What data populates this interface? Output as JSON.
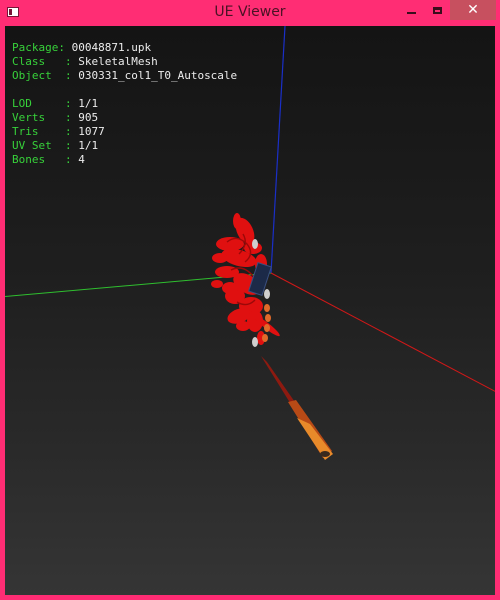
{
  "window": {
    "title": "UE Viewer",
    "close_glyph": "✕",
    "icons": {
      "app": "app-icon",
      "minimize": "minimize-icon",
      "maximize": "maximize-icon",
      "close": "close-icon"
    }
  },
  "hud": {
    "package": {
      "label": "Package: ",
      "value": "00048871.upk"
    },
    "class": {
      "label": "Class   : ",
      "value": "SkeletalMesh"
    },
    "object": {
      "label": "Object  : ",
      "value": "030331_col1_T0_Autoscale"
    },
    "lod": {
      "label": "LOD     : ",
      "value": "1/1"
    },
    "verts": {
      "label": "Verts   : ",
      "value": "905"
    },
    "tris": {
      "label": "Tris    : ",
      "value": "1077"
    },
    "uvset": {
      "label": "UV Set  : ",
      "value": "1/1"
    },
    "bones": {
      "label": "Bones   : ",
      "value": "4"
    }
  },
  "colors": {
    "window_frame": "#ff2d74",
    "close_button": "#c7505f",
    "hud_label": "#37d13a",
    "hud_value": "#ececec",
    "axis_x": "#d01818",
    "axis_y": "#2fbf2f",
    "axis_z": "#1a2fc8",
    "mesh_red": "#e01010",
    "mesh_orange": "#e88a2a"
  }
}
